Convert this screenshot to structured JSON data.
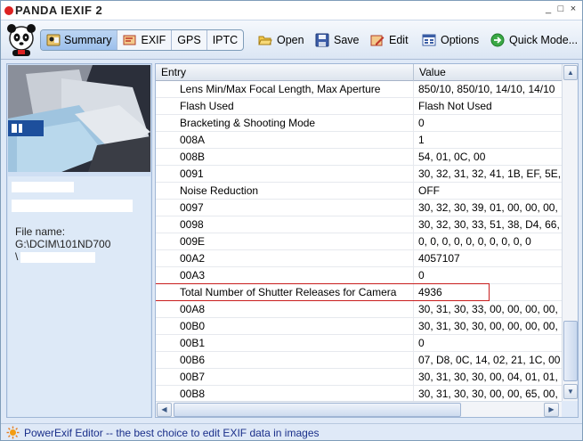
{
  "app": {
    "title": "PANDA IEXIF 2"
  },
  "window_controls": [
    "_",
    "□",
    "×"
  ],
  "tabs": [
    {
      "label": "Summary",
      "icon": "summary-icon",
      "active": true
    },
    {
      "label": "EXIF",
      "icon": "exif-icon",
      "active": false
    },
    {
      "label": "GPS",
      "icon": "",
      "active": false
    },
    {
      "label": "IPTC",
      "icon": "",
      "active": false
    }
  ],
  "toolbar": {
    "open_label": "Open",
    "save_label": "Save",
    "edit_label": "Edit",
    "options_label": "Options",
    "quick_mode_label": "Quick Mode..."
  },
  "left_panel": {
    "file_name_label": "File name:",
    "file_path": "G:\\DCIM\\101ND700",
    "file_path_2": "\\"
  },
  "table": {
    "columns": [
      "Entry",
      "Value"
    ],
    "rows": [
      {
        "entry": "Lens Min/Max Focal Length, Max Aperture",
        "value": "850/10, 850/10, 14/10, 14/10"
      },
      {
        "entry": "Flash Used",
        "value": "Flash Not Used"
      },
      {
        "entry": "Bracketing & Shooting Mode",
        "value": "0"
      },
      {
        "entry": "008A",
        "value": "1"
      },
      {
        "entry": "008B",
        "value": "54, 01, 0C, 00"
      },
      {
        "entry": "0091",
        "value": "30, 32, 31, 32, 41, 1B, EF, 5E,"
      },
      {
        "entry": "Noise Reduction",
        "value": "OFF"
      },
      {
        "entry": "0097",
        "value": "30, 32, 30, 39, 01, 00, 00, 00,"
      },
      {
        "entry": "0098",
        "value": "30, 32, 30, 33, 51, 38, D4, 66,"
      },
      {
        "entry": "009E",
        "value": "0, 0, 0, 0, 0, 0, 0, 0, 0, 0"
      },
      {
        "entry": "00A2",
        "value": "4057107"
      },
      {
        "entry": "00A3",
        "value": "0"
      },
      {
        "entry": "Total Number of Shutter Releases for Camera",
        "value": "4936",
        "highlighted": true
      },
      {
        "entry": "00A8",
        "value": "30, 31, 30, 33, 00, 00, 00, 00,"
      },
      {
        "entry": "00B0",
        "value": "30, 31, 30, 30, 00, 00, 00, 00,"
      },
      {
        "entry": "00B1",
        "value": "0"
      },
      {
        "entry": "00B6",
        "value": "07, D8, 0C, 14, 02, 21, 1C, 00"
      },
      {
        "entry": "00B7",
        "value": "30, 31, 30, 30, 00, 04, 01, 01,"
      },
      {
        "entry": "00B8",
        "value": "30, 31, 30, 30, 00, 00, 65, 00,"
      }
    ]
  },
  "status": {
    "text": "PowerExif Editor -- the best choice to edit EXIF data in images"
  },
  "colors": {
    "accent": "#1a2f8a",
    "highlight_border": "#c81e1e",
    "panel": "#dfe9f7"
  }
}
